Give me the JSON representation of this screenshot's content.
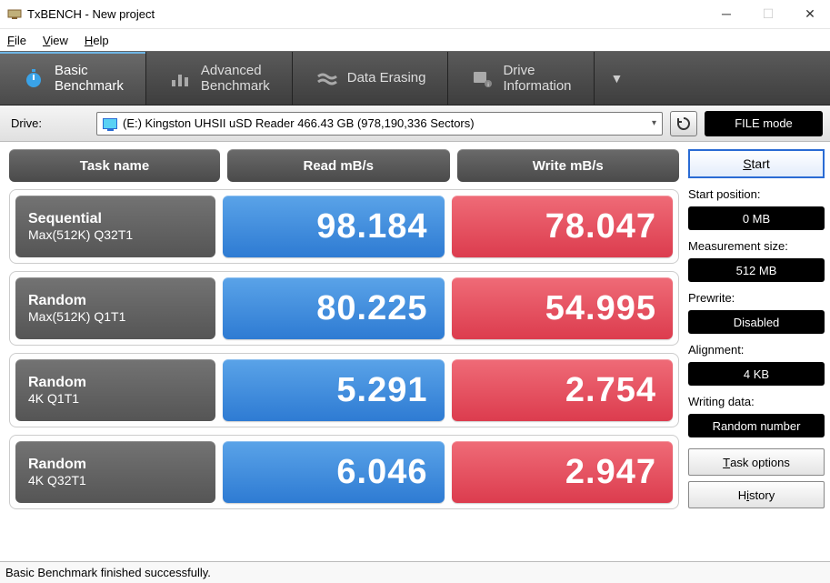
{
  "window": {
    "title": "TxBENCH - New project"
  },
  "menu": {
    "file": "File",
    "view": "View",
    "help": "Help"
  },
  "tabs": {
    "basic": "Basic\nBenchmark",
    "advanced": "Advanced\nBenchmark",
    "erase": "Data Erasing",
    "info": "Drive\nInformation"
  },
  "drivebar": {
    "label": "Drive:",
    "selected": "(E:) Kingston UHSII uSD Reader  466.43 GB (978,190,336 Sectors)",
    "filemode": "FILE mode"
  },
  "headers": {
    "task": "Task name",
    "read": "Read mB/s",
    "write": "Write mB/s"
  },
  "rows": [
    {
      "t1": "Sequential",
      "t2": "Max(512K) Q32T1",
      "read": "98.184",
      "write": "78.047"
    },
    {
      "t1": "Random",
      "t2": "Max(512K) Q1T1",
      "read": "80.225",
      "write": "54.995"
    },
    {
      "t1": "Random",
      "t2": "4K Q1T1",
      "read": "5.291",
      "write": "2.754"
    },
    {
      "t1": "Random",
      "t2": "4K Q32T1",
      "read": "6.046",
      "write": "2.947"
    }
  ],
  "side": {
    "start": "Start",
    "startpos_label": "Start position:",
    "startpos_val": "0 MB",
    "msize_label": "Measurement size:",
    "msize_val": "512 MB",
    "prewrite_label": "Prewrite:",
    "prewrite_val": "Disabled",
    "align_label": "Alignment:",
    "align_val": "4 KB",
    "wdata_label": "Writing data:",
    "wdata_val": "Random number",
    "taskopt": "Task options",
    "history": "History"
  },
  "status": "Basic Benchmark finished successfully."
}
